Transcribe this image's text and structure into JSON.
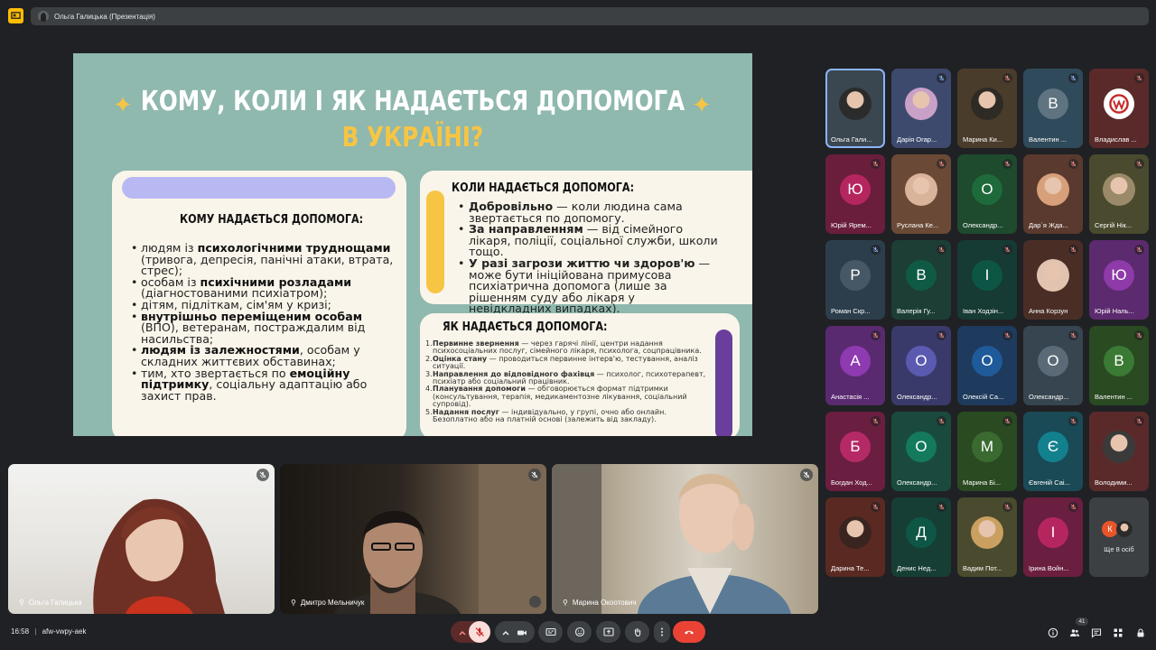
{
  "meeting": {
    "presenter_label": "Ольга Галицька (Презентація)",
    "time": "16:58",
    "separator": "|",
    "code": "afw-vwpy-aek",
    "participant_count": "41"
  },
  "slide": {
    "title_line1": "КОМУ, КОЛИ І ЯК НАДАЄТЬСЯ ДОПОМОГА",
    "title_line2": "В УКРАЇНІ?",
    "left_heading": "КОМУ НАДАЄТЬСЯ ДОПОМОГА:",
    "left_items": [
      {
        "pre": "людям із ",
        "bold": "психологічними труднощами",
        "post": " (тривога, депресія, панічні атаки, втрата, стрес);"
      },
      {
        "pre": "особам із ",
        "bold": "психічними розладами",
        "post": " (діагностованими психіатром);"
      },
      {
        "pre": "дітям, підліткам, сім'ям у кризі;",
        "bold": "",
        "post": ""
      },
      {
        "pre": "",
        "bold": "внутрішньо переміщеним особам",
        "post": " (ВПО), ветеранам, постраждалим від насильства;"
      },
      {
        "pre": "",
        "bold": "людям із залежностями",
        "post": ", особам у складних життєвих обставинах;"
      },
      {
        "pre": "тим, хто звертається по ",
        "bold": "емоційну підтримку",
        "post": ", соціальну адаптацію або захист прав."
      }
    ],
    "when_heading": "КОЛИ НАДАЄТЬСЯ ДОПОМОГА:",
    "when_items": [
      {
        "bold": "Добровільно",
        "post": " — коли людина сама звертається по допомогу."
      },
      {
        "bold": "За направленням",
        "post": " — від сімейного лікаря, поліції, соціальної служби, школи тощо."
      },
      {
        "bold": "У разі загрози життю чи здоров'ю",
        "post": " — може бути ініційована примусова психіатрична допомога (лише за рішенням суду або лікаря у невідкладних випадках)."
      }
    ],
    "how_heading": "ЯК НАДАЄТЬСЯ ДОПОМОГА:",
    "how_items": [
      {
        "n": "1.",
        "bold": "Первинне звернення",
        "post": " — через гарячі лінії, центри надання психосоціальних послуг, сімейного лікаря, психолога, соцпрацівника."
      },
      {
        "n": "2.",
        "bold": "Оцінка стану",
        "post": " — проводиться первинне інтерв'ю, тестування, аналіз ситуації."
      },
      {
        "n": "3.",
        "bold": "Направлення до відповідного фахівця",
        "post": " — психолог, психотерапевт, психіатр або соціальний працівник."
      },
      {
        "n": "4.",
        "bold": "Планування допомоги",
        "post": " — обговорюється формат підтримки (консультування, терапія, медикаментозне лікування, соціальний супровід)."
      },
      {
        "n": "5.",
        "bold": "Надання послуг",
        "post": " — індивідуально, у групі, очно або онлайн. Безоплатно або на платній основі (залежить від закладу)."
      }
    ]
  },
  "participants": [
    {
      "name": "Ольга Гали...",
      "kind": "photo",
      "bg": "#3a4650",
      "face": "#2b2b2b",
      "mic": "none",
      "selected": true
    },
    {
      "name": "Дарія Огар...",
      "kind": "photo",
      "bg": "#3d4a6e",
      "face": "#c9a0c8",
      "mic": "muted-blue"
    },
    {
      "name": "Марина Ки...",
      "kind": "photo",
      "bg": "#4a3c2a",
      "face": "#2e2a24",
      "mic": "muted"
    },
    {
      "name": "Валентин ...",
      "kind": "letter",
      "letter": "В",
      "bg": "#2f4a5a",
      "circ": "#5f7380",
      "mic": "muted-blue"
    },
    {
      "name": "Владислав ...",
      "kind": "logo",
      "bg": "#5a2a2a",
      "mic": "muted"
    },
    {
      "name": "Юрій Ярем...",
      "kind": "letter",
      "letter": "Ю",
      "bg": "#6a1e3c",
      "circ": "#b5265f",
      "mic": "muted"
    },
    {
      "name": "Руслана Ке...",
      "kind": "photo",
      "bg": "#6a4a36",
      "face": "#d9b39a",
      "mic": "muted"
    },
    {
      "name": "Олександр...",
      "kind": "letter",
      "letter": "О",
      "bg": "#1e4a2e",
      "circ": "#1f6a3a",
      "mic": "muted"
    },
    {
      "name": "Дар`я Жда...",
      "kind": "photo",
      "bg": "#5a3a2e",
      "face": "#d7a07a",
      "mic": "muted"
    },
    {
      "name": "Сергій Нік...",
      "kind": "photo",
      "bg": "#4a4a2e",
      "face": "#9a8a6a",
      "mic": "muted"
    },
    {
      "name": "Роман Скр...",
      "kind": "letter",
      "letter": "Р",
      "bg": "#2c3e4c",
      "circ": "#465866",
      "mic": "muted-blue"
    },
    {
      "name": "Валерія Гу...",
      "kind": "letter",
      "letter": "В",
      "bg": "#1c3e34",
      "circ": "#0f5a44",
      "mic": "muted"
    },
    {
      "name": "Іван Ходзін...",
      "kind": "letter",
      "letter": "І",
      "bg": "#163a34",
      "circ": "#0d5646",
      "mic": "muted"
    },
    {
      "name": "Анна Корзун",
      "kind": "photo",
      "bg": "#4a2e26",
      "face": "#e2c3b0",
      "mic": "muted"
    },
    {
      "name": "Юрій Наль...",
      "kind": "letter",
      "letter": "Ю",
      "bg": "#5c2a6e",
      "circ": "#8e3aa8",
      "mic": "muted"
    },
    {
      "name": "Анастасія ...",
      "kind": "letter",
      "letter": "А",
      "bg": "#5a2a70",
      "circ": "#8e3ab0",
      "mic": "muted"
    },
    {
      "name": "Олександр...",
      "kind": "letter",
      "letter": "О",
      "bg": "#3a3a6a",
      "circ": "#5a5ab0",
      "mic": "muted"
    },
    {
      "name": "Олексій Са...",
      "kind": "letter",
      "letter": "О",
      "bg": "#1e3a5c",
      "circ": "#1f5a9a",
      "mic": "muted"
    },
    {
      "name": "Олександр...",
      "kind": "letter",
      "letter": "О",
      "bg": "#36454f",
      "circ": "#5a6a76",
      "mic": "muted"
    },
    {
      "name": "Валентин ...",
      "kind": "letter",
      "letter": "В",
      "bg": "#2a4a22",
      "circ": "#3a7a34",
      "mic": "muted"
    },
    {
      "name": "Богдан Ход...",
      "kind": "letter",
      "letter": "Б",
      "bg": "#6a1e40",
      "circ": "#b52a66",
      "mic": "muted"
    },
    {
      "name": "Олександр...",
      "kind": "letter",
      "letter": "О",
      "bg": "#1a4a3e",
      "circ": "#137a5e",
      "mic": "muted"
    },
    {
      "name": "Марина Бі...",
      "kind": "letter",
      "letter": "М",
      "bg": "#2a4a22",
      "circ": "#3a6a30",
      "mic": "muted"
    },
    {
      "name": "Євгеній Саі...",
      "kind": "letter",
      "letter": "Є",
      "bg": "#1a4a56",
      "circ": "#13808e",
      "mic": "muted"
    },
    {
      "name": "Володими...",
      "kind": "photo",
      "bg": "#5a2a2a",
      "face": "#3a3a3a",
      "mic": "muted"
    },
    {
      "name": "Дарина Те...",
      "kind": "photo",
      "bg": "#5a2a22",
      "face": "#3a2420",
      "mic": "muted"
    },
    {
      "name": "Денис Нед...",
      "kind": "letter",
      "letter": "Д",
      "bg": "#163e34",
      "circ": "#0e5646",
      "mic": "muted"
    },
    {
      "name": "Вадим Пот...",
      "kind": "photo",
      "bg": "#4a4a2e",
      "face": "#c9a060",
      "mic": "muted"
    },
    {
      "name": "Ірина Войн...",
      "kind": "letter",
      "letter": "І",
      "bg": "#6a1e40",
      "circ": "#b5265f",
      "mic": "muted"
    }
  ],
  "more": {
    "label": "Ще 8 осіб",
    "avatar_letter": "К"
  },
  "videos": [
    {
      "name": "Ольга Галицька"
    },
    {
      "name": "Дмитро Мельничук"
    },
    {
      "name": "Марина Окоотович"
    }
  ],
  "colors": {
    "accent_red": "#ea4335",
    "bar_bg": "#3c4043",
    "selected_outline": "#8ab4f8",
    "slide_bg": "#8fb8ae",
    "slide_gold": "#f6c544"
  },
  "icons": {
    "controls": [
      "chevron-up-icon",
      "mic-off-icon",
      "chevron-up-icon",
      "camera-icon",
      "captions-icon",
      "emoji-icon",
      "present-icon",
      "raise-hand-icon",
      "more-icon",
      "hang-up-icon"
    ],
    "right": [
      "info-icon",
      "people-icon",
      "chat-icon",
      "activities-icon",
      "lock-icon"
    ]
  }
}
